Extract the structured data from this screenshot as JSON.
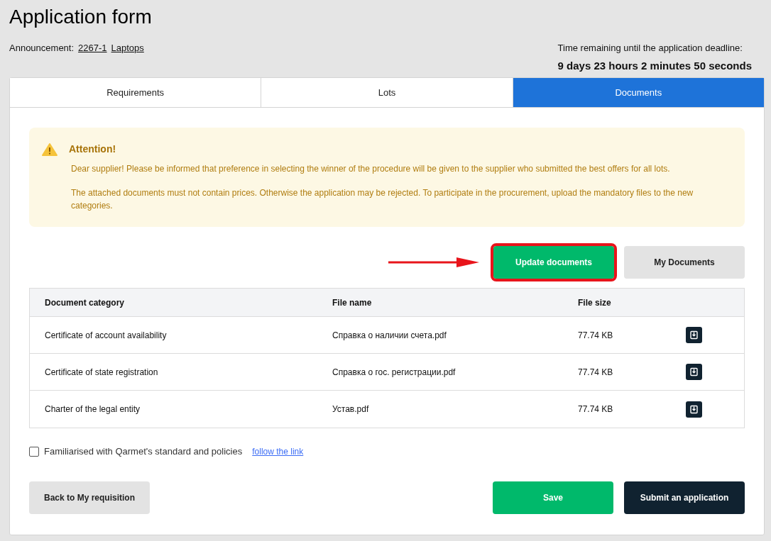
{
  "title": "Application form",
  "announcement": {
    "label": "Announcement:",
    "number": "2267-1",
    "subject": "Laptops"
  },
  "deadline": {
    "label": "Time remaining until the application deadline:",
    "value": "9 days 23 hours 2 minutes 50 seconds"
  },
  "tabs": [
    {
      "label": "Requirements",
      "selected": false
    },
    {
      "label": "Lots",
      "selected": false
    },
    {
      "label": "Documents",
      "selected": true
    }
  ],
  "alert": {
    "title": "Attention!",
    "paragraphs": [
      "Dear supplier! Please be informed that preference in selecting the winner of the procedure will be given to the supplier who submitted the best offers for all lots.",
      "The attached documents must not contain prices. Otherwise the application may be rejected. To participate in the procurement, upload the mandatory files to the new categories."
    ]
  },
  "document_buttons": [
    {
      "label": "Update documents",
      "kind": "primary",
      "highlighted": true
    },
    {
      "label": "My Documents",
      "kind": "secondary",
      "highlighted": false
    }
  ],
  "table": {
    "columns": [
      "Document category",
      "File name",
      "File size"
    ],
    "rows": [
      {
        "category": "Certificate of account availability",
        "file": "Справка о наличии счета.pdf",
        "size": "77.74 KB"
      },
      {
        "category": "Certificate of state registration",
        "file": "Справка о гос. регистрации.pdf",
        "size": "77.74 KB"
      },
      {
        "category": "Charter of the legal entity",
        "file": "Устав.pdf",
        "size": "77.74 KB"
      }
    ]
  },
  "agreement": {
    "label": "Familiarised with Qarmet's standard and policies",
    "checked": false,
    "link": "follow the link"
  },
  "footer_buttons": [
    {
      "label": "Back to My requisition",
      "kind": "secondary"
    },
    {
      "label": "Save",
      "kind": "primary"
    },
    {
      "label": "Submit an application",
      "kind": "dark"
    }
  ]
}
